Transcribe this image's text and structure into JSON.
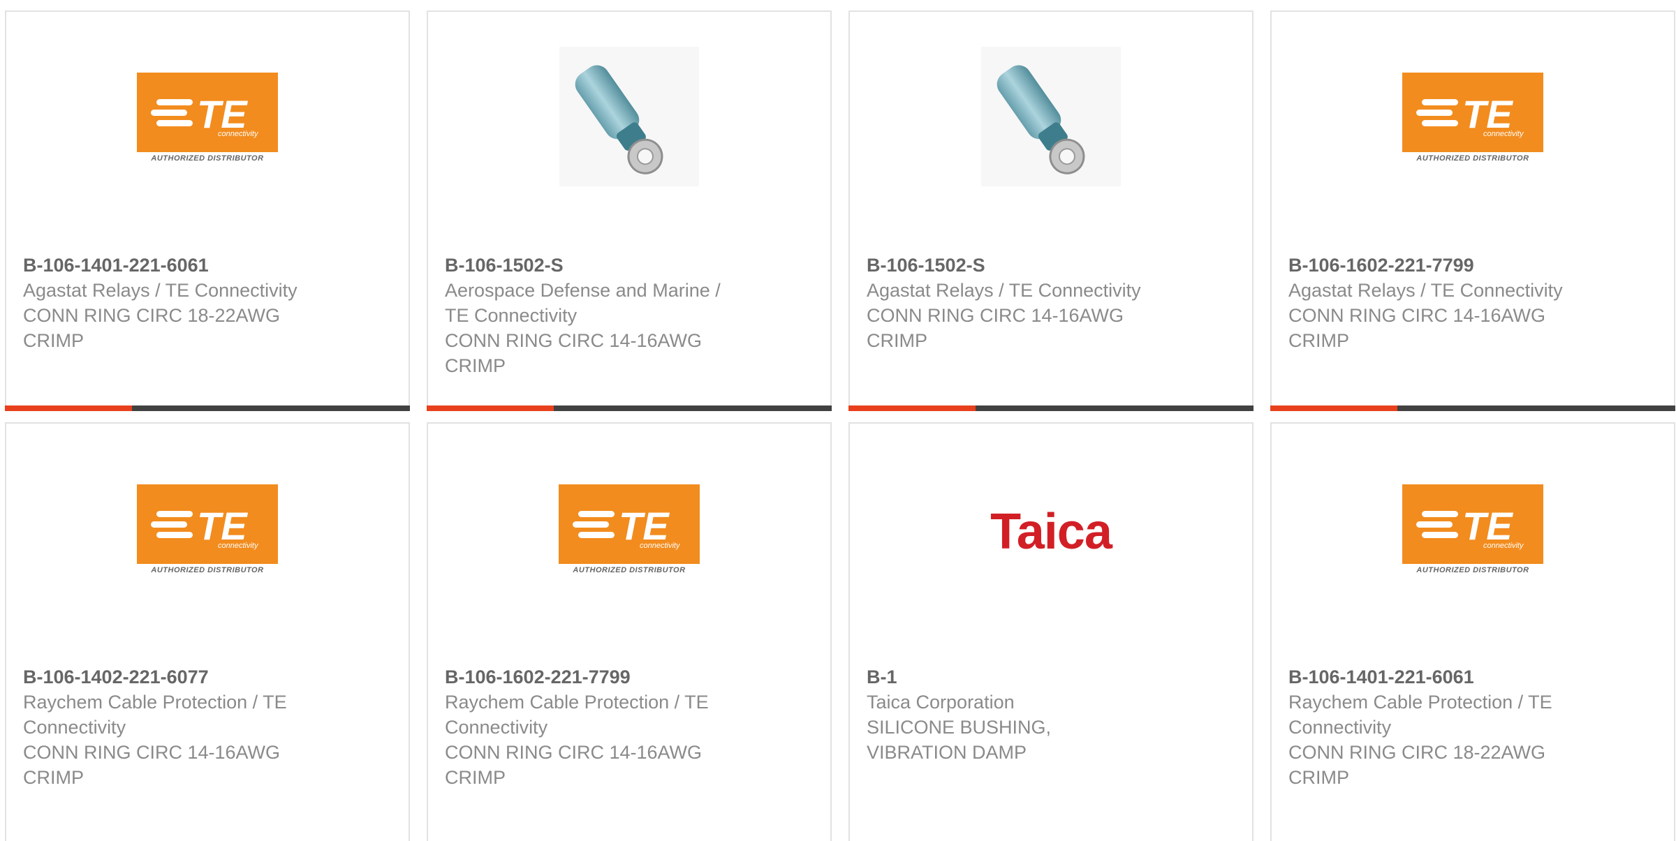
{
  "cards": [
    {
      "image": "te-logo",
      "part": "B-106-1401-221-6061",
      "line1": "Agastat Relays / TE Connectivity",
      "line2": "CONN RING CIRC 18-22AWG",
      "line3": "CRIMP",
      "line4": ""
    },
    {
      "image": "ring-terminal-photo",
      "part": "B-106-1502-S",
      "line1": "Aerospace Defense and Marine /",
      "line2": "TE Connectivity",
      "line3": "CONN RING CIRC 14-16AWG",
      "line4": "CRIMP"
    },
    {
      "image": "ring-terminal-photo",
      "part": "B-106-1502-S",
      "line1": "Agastat Relays / TE Connectivity",
      "line2": "CONN RING CIRC 14-16AWG",
      "line3": "CRIMP",
      "line4": ""
    },
    {
      "image": "te-logo",
      "part": "B-106-1602-221-7799",
      "line1": "Agastat Relays / TE Connectivity",
      "line2": "CONN RING CIRC 14-16AWG",
      "line3": "CRIMP",
      "line4": ""
    },
    {
      "image": "te-logo",
      "part": "B-106-1402-221-6077",
      "line1": "Raychem Cable Protection / TE",
      "line2": "Connectivity",
      "line3": "CONN RING CIRC 14-16AWG",
      "line4": "CRIMP"
    },
    {
      "image": "te-logo",
      "part": "B-106-1602-221-7799",
      "line1": "Raychem Cable Protection / TE",
      "line2": "Connectivity",
      "line3": "CONN RING CIRC 14-16AWG",
      "line4": "CRIMP"
    },
    {
      "image": "taica-logo",
      "part": "B-1",
      "line1": "Taica Corporation",
      "line2": "SILICONE BUSHING,",
      "line3": "VIBRATION DAMP",
      "line4": ""
    },
    {
      "image": "te-logo",
      "part": "B-106-1401-221-6061",
      "line1": "Raychem Cable Protection / TE",
      "line2": "Connectivity",
      "line3": "CONN RING CIRC 18-22AWG",
      "line4": "CRIMP"
    }
  ],
  "te_logo": {
    "word": "TE",
    "sub": "connectivity",
    "caption": "AUTHORIZED DISTRIBUTOR"
  },
  "taica_logo": {
    "word": "Taica"
  },
  "colors": {
    "accent": "#e8401c",
    "bar": "#414141",
    "te_orange": "#f28c1e",
    "taica_red": "#d21f26"
  }
}
